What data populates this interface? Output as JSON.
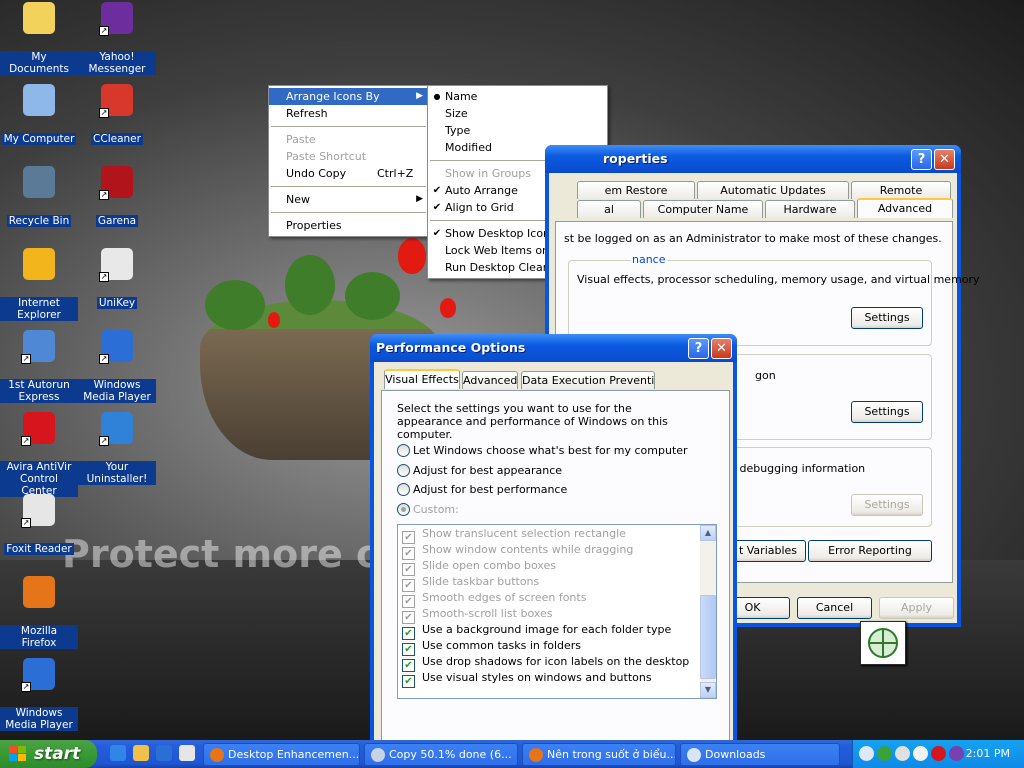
{
  "desktop": {
    "icons": [
      {
        "label": "My Documents",
        "icon": "my-documents-icon",
        "color": "#f3d25c",
        "shortcut": false
      },
      {
        "label": "Yahoo! Messenger",
        "icon": "yahoo-messenger-icon",
        "color": "#6d2d9c",
        "shortcut": true
      },
      {
        "label": "My Computer",
        "icon": "my-computer-icon",
        "color": "#8fb8ea",
        "shortcut": false
      },
      {
        "label": "CCleaner",
        "icon": "ccleaner-icon",
        "color": "#d8382b",
        "shortcut": true
      },
      {
        "label": "Recycle Bin",
        "icon": "recycle-bin-icon",
        "color": "#5b7a98",
        "shortcut": false
      },
      {
        "label": "Garena",
        "icon": "garena-icon",
        "color": "#b1141a",
        "shortcut": true
      },
      {
        "label": "Internet Explorer",
        "icon": "internet-explorer-icon",
        "color": "#f2b51c",
        "shortcut": false
      },
      {
        "label": "UniKey",
        "icon": "unikey-icon",
        "color": "#e8e8e8",
        "shortcut": true
      },
      {
        "label": "1st Autorun Express",
        "icon": "autorun-express-icon",
        "color": "#4f89d6",
        "shortcut": true
      },
      {
        "label": "Windows Media Player",
        "icon": "windows-media-player-icon",
        "color": "#2b6fd6",
        "shortcut": true
      },
      {
        "label": "Avira AntiVir Control Center",
        "icon": "avira-icon",
        "color": "#d7151d",
        "shortcut": true
      },
      {
        "label": "Your Uninstaller!",
        "icon": "your-uninstaller-icon",
        "color": "#2f82d8",
        "shortcut": true
      },
      {
        "label": "Foxit Reader",
        "icon": "foxit-reader-icon",
        "color": "#e6e6e6",
        "shortcut": true
      },
      {
        "label": "Mozilla Firefox",
        "icon": "firefox-icon",
        "color": "#e67419",
        "shortcut": false
      },
      {
        "label": "Windows Media Player",
        "icon": "windows-media-player-icon",
        "color": "#2b6fd6",
        "shortcut": true
      }
    ],
    "watermark": {
      "line1": "Protect more of your memories for less!"
    }
  },
  "context_menu": {
    "items": [
      {
        "label": "Arrange Icons By",
        "type": "submenu",
        "selected": true
      },
      {
        "label": "Refresh",
        "type": "item"
      },
      {
        "type": "sep"
      },
      {
        "label": "Paste",
        "type": "disabled"
      },
      {
        "label": "Paste Shortcut",
        "type": "disabled"
      },
      {
        "label": "Undo Copy",
        "type": "item",
        "accel": "Ctrl+Z"
      },
      {
        "type": "sep"
      },
      {
        "label": "New",
        "type": "submenu"
      },
      {
        "type": "sep"
      },
      {
        "label": "Properties",
        "type": "item"
      }
    ]
  },
  "arrange_submenu": {
    "items": [
      {
        "label": "Name",
        "mark": "bullet"
      },
      {
        "label": "Size",
        "mark": ""
      },
      {
        "label": "Type",
        "mark": ""
      },
      {
        "label": "Modified",
        "mark": ""
      },
      {
        "type": "sep"
      },
      {
        "label": "Show in Groups",
        "mark": "",
        "disabled": true
      },
      {
        "label": "Auto Arrange",
        "mark": "check"
      },
      {
        "label": "Align to Grid",
        "mark": "check"
      },
      {
        "type": "sep"
      },
      {
        "label": "Show Desktop Icons",
        "mark": "check"
      },
      {
        "label": "Lock Web Items on Desktop",
        "mark": ""
      },
      {
        "label": "Run Desktop Cleanup Wizard",
        "mark": ""
      }
    ]
  },
  "system_properties": {
    "title": "roperties",
    "tabs_row1": [
      "em Restore",
      "Automatic Updates",
      "Remote"
    ],
    "tabs_row2": [
      "al",
      "Computer Name",
      "Hardware",
      "Advanced"
    ],
    "notice": "st be logged on as an Administrator to make most of these changes.",
    "perf_group_label": "nance",
    "perf_desc": "Visual effects, processor scheduling, memory usage, and virtual memory",
    "profiles_desc": "gon",
    "startup_desc": "d debugging information",
    "settings_label": "Settings",
    "env_button": "t Variables",
    "error_button": "Error Reporting",
    "ok": "OK",
    "cancel": "Cancel",
    "apply": "Apply"
  },
  "performance_options": {
    "title": "Performance Options",
    "tabs": [
      "Visual Effects",
      "Advanced",
      "Data Execution Prevention"
    ],
    "intro": "Select the settings you want to use for the appearance and performance of Windows on this computer.",
    "radios": [
      {
        "label": "Let Windows choose what's best for my computer",
        "checked": false,
        "disabled": false
      },
      {
        "label": "Adjust for best appearance",
        "checked": false,
        "disabled": false
      },
      {
        "label": "Adjust for best performance",
        "checked": false,
        "disabled": false
      },
      {
        "label": "Custom:",
        "checked": true,
        "disabled": true
      }
    ],
    "effects": [
      {
        "label": "Show translucent selection rectangle",
        "checked": true,
        "disabled": true
      },
      {
        "label": "Show window contents while dragging",
        "checked": true,
        "disabled": true
      },
      {
        "label": "Slide open combo boxes",
        "checked": true,
        "disabled": true
      },
      {
        "label": "Slide taskbar buttons",
        "checked": true,
        "disabled": true
      },
      {
        "label": "Smooth edges of screen fonts",
        "checked": true,
        "disabled": true
      },
      {
        "label": "Smooth-scroll list boxes",
        "checked": true,
        "disabled": true
      },
      {
        "label": "Use a background image for each folder type",
        "checked": true,
        "disabled": false
      },
      {
        "label": "Use common tasks in folders",
        "checked": true,
        "disabled": false
      },
      {
        "label": "Use drop shadows for icon labels on the desktop",
        "checked": true,
        "disabled": false
      },
      {
        "label": "Use visual styles on windows and buttons",
        "checked": true,
        "disabled": false
      }
    ]
  },
  "taskbar": {
    "start_label": "start",
    "quick_launch": [
      "ie-quicklaunch-icon",
      "show-desktop-icon",
      "media-player-quicklaunch-icon",
      "unikey-quicklaunch-icon"
    ],
    "buttons": [
      {
        "label": "Desktop Enhancemen...",
        "icon": "firefox-icon",
        "color": "#e67419"
      },
      {
        "label": "Copy 50.1% done (6...",
        "icon": "copy-progress-icon",
        "color": "#c8d3e6"
      },
      {
        "label": "Nên trong suốt ở biểu...",
        "icon": "firefox-icon",
        "color": "#e67419"
      },
      {
        "label": "Downloads",
        "icon": "downloads-icon",
        "color": "#d9e4f5"
      }
    ],
    "tray_icons": [
      "back-arrow-icon",
      "network-icon",
      "volume-icon",
      "unikey-tray-icon",
      "avira-tray-icon",
      "yahoo-tray-icon"
    ],
    "clock": "2:01 PM"
  },
  "colors": {
    "selection": "#316ac5",
    "xp_blue": "#0854e3",
    "taskbar": "#245edb",
    "start_green": "#389b34"
  }
}
